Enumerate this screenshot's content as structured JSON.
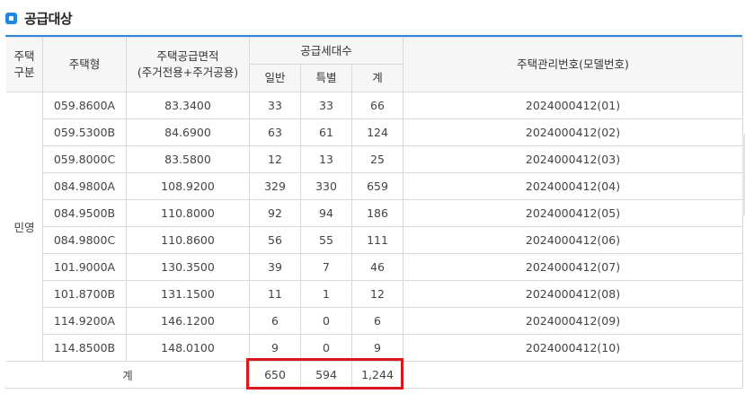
{
  "section": {
    "title": "공급대상"
  },
  "headers": {
    "house_type_group_l1": "주택",
    "house_type_group_l2": "구분",
    "house_model": "주택형",
    "area_l1": "주택공급면적",
    "area_l2": "(주거전용+주거공용)",
    "households": "공급세대수",
    "general": "일반",
    "special": "특별",
    "total": "계",
    "mgmt_no": "주택관리번호(모델번호)"
  },
  "group_label": "민영",
  "rows": [
    {
      "model": "059.8600A",
      "area": "83.3400",
      "general": "33",
      "special": "33",
      "total": "66",
      "mgmt": "2024000412(01)"
    },
    {
      "model": "059.5300B",
      "area": "84.6900",
      "general": "63",
      "special": "61",
      "total": "124",
      "mgmt": "2024000412(02)"
    },
    {
      "model": "059.8000C",
      "area": "83.5800",
      "general": "12",
      "special": "13",
      "total": "25",
      "mgmt": "2024000412(03)"
    },
    {
      "model": "084.9800A",
      "area": "108.9200",
      "general": "329",
      "special": "330",
      "total": "659",
      "mgmt": "2024000412(04)"
    },
    {
      "model": "084.9500B",
      "area": "110.8000",
      "general": "92",
      "special": "94",
      "total": "186",
      "mgmt": "2024000412(05)"
    },
    {
      "model": "084.9800C",
      "area": "110.8600",
      "general": "56",
      "special": "55",
      "total": "111",
      "mgmt": "2024000412(06)"
    },
    {
      "model": "101.9000A",
      "area": "130.3500",
      "general": "39",
      "special": "7",
      "total": "46",
      "mgmt": "2024000412(07)"
    },
    {
      "model": "101.8700B",
      "area": "131.1500",
      "general": "11",
      "special": "1",
      "total": "12",
      "mgmt": "2024000412(08)"
    },
    {
      "model": "114.9200A",
      "area": "146.1200",
      "general": "6",
      "special": "0",
      "total": "6",
      "mgmt": "2024000412(09)"
    },
    {
      "model": "114.8500B",
      "area": "148.0100",
      "general": "9",
      "special": "0",
      "total": "9",
      "mgmt": "2024000412(10)"
    }
  ],
  "totals": {
    "label": "계",
    "general": "650",
    "special": "594",
    "total": "1,244"
  },
  "colors": {
    "accent": "#1e88e5",
    "highlight": "#d7191f"
  }
}
